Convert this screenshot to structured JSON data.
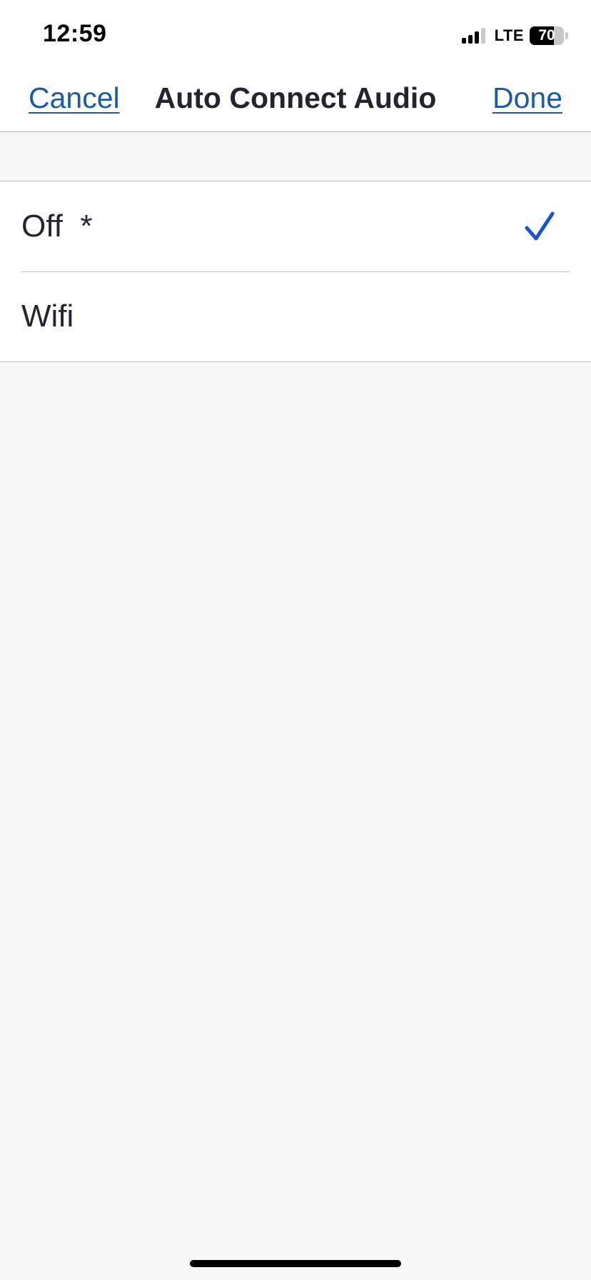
{
  "status_bar": {
    "time": "12:59",
    "network": "LTE",
    "battery_percent": 70,
    "battery_label": "70",
    "signal_bars_active": 3,
    "signal_bars_total": 4
  },
  "nav": {
    "cancel_label": "Cancel",
    "title": "Auto Connect Audio",
    "done_label": "Done"
  },
  "options": [
    {
      "label": "Off  *",
      "selected": true,
      "icon": "checkmark-icon"
    },
    {
      "label": "Wifi",
      "selected": false
    }
  ],
  "colors": {
    "accent": "#1a5aa8",
    "checkmark": "#1a4fd8",
    "text": "#24232f",
    "background": "#f7f7f7"
  }
}
